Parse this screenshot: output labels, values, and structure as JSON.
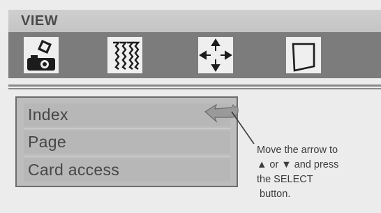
{
  "header": {
    "title": "VIEW"
  },
  "toolbar": {
    "icons": [
      {
        "name": "projector-adjust-icon"
      },
      {
        "name": "zigzag-pattern-icon"
      },
      {
        "name": "move-arrows-icon"
      },
      {
        "name": "keystone-frame-icon"
      }
    ]
  },
  "menu": {
    "items": [
      {
        "label": "Index"
      },
      {
        "label": "Page"
      },
      {
        "label": "Card access"
      }
    ],
    "selected_index": 0
  },
  "callout": {
    "line1": "Move the arrow to",
    "line2": "▲ or ▼ and press",
    "line3": "the SELECT",
    "line4": "button."
  }
}
